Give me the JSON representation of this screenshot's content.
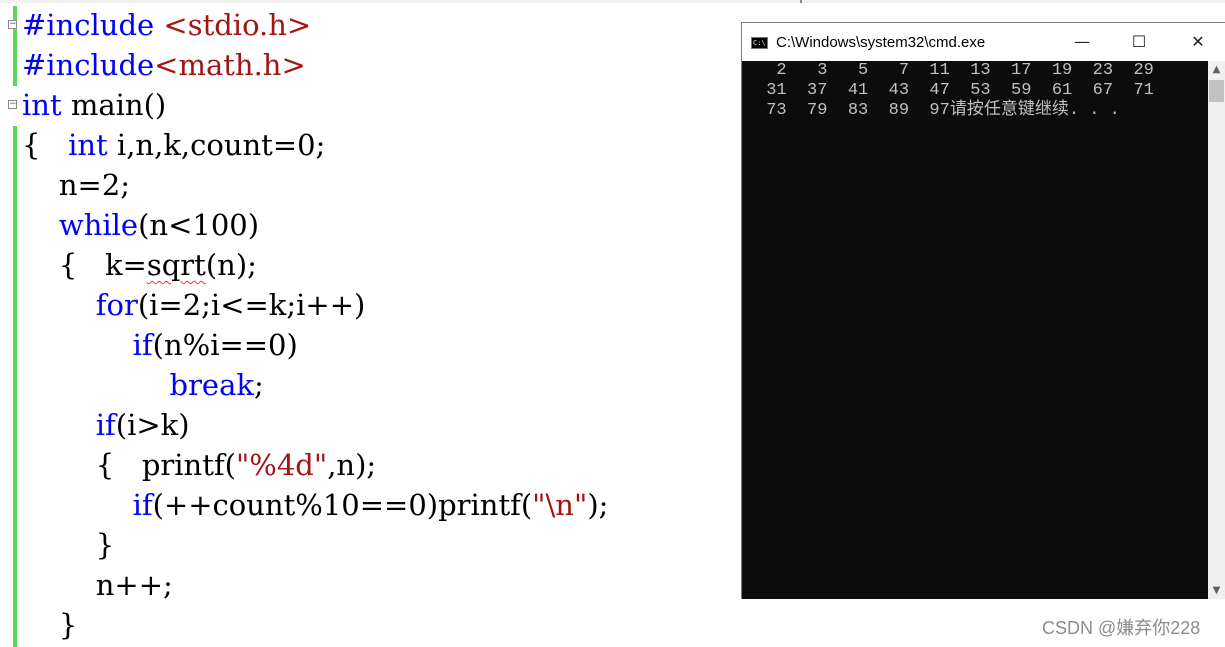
{
  "editor": {
    "lines": [
      {
        "parts": [
          {
            "t": "#include ",
            "c": "pp"
          },
          {
            "t": "<stdio.h>",
            "c": "inc"
          }
        ]
      },
      {
        "parts": [
          {
            "t": "#include",
            "c": "pp"
          },
          {
            "t": "<math.h>",
            "c": "inc"
          }
        ]
      },
      {
        "parts": [
          {
            "t": "int",
            "c": "kw"
          },
          {
            "t": " main()",
            "c": ""
          }
        ]
      },
      {
        "parts": [
          {
            "t": "{   ",
            "c": ""
          },
          {
            "t": "int",
            "c": "kw"
          },
          {
            "t": " i,n,k,count=0;",
            "c": ""
          }
        ]
      },
      {
        "parts": [
          {
            "t": "    n=2;",
            "c": ""
          }
        ]
      },
      {
        "parts": [
          {
            "t": "    ",
            "c": ""
          },
          {
            "t": "while",
            "c": "kw"
          },
          {
            "t": "(n<100)",
            "c": ""
          }
        ]
      },
      {
        "parts": [
          {
            "t": "    {   k=",
            "c": ""
          },
          {
            "t": "sqrt",
            "c": "squig"
          },
          {
            "t": "(n);",
            "c": ""
          }
        ]
      },
      {
        "parts": [
          {
            "t": "        ",
            "c": ""
          },
          {
            "t": "for",
            "c": "kw"
          },
          {
            "t": "(i=2;i<=k;i++)",
            "c": ""
          }
        ]
      },
      {
        "parts": [
          {
            "t": "            ",
            "c": ""
          },
          {
            "t": "if",
            "c": "kw"
          },
          {
            "t": "(n%i==0)",
            "c": ""
          }
        ]
      },
      {
        "parts": [
          {
            "t": "                ",
            "c": ""
          },
          {
            "t": "break",
            "c": "kw"
          },
          {
            "t": ";",
            "c": ""
          }
        ]
      },
      {
        "parts": [
          {
            "t": "        ",
            "c": ""
          },
          {
            "t": "if",
            "c": "kw"
          },
          {
            "t": "(i>k)",
            "c": ""
          }
        ]
      },
      {
        "parts": [
          {
            "t": "        {   printf(",
            "c": ""
          },
          {
            "t": "\"%4d\"",
            "c": "str"
          },
          {
            "t": ",n);",
            "c": ""
          }
        ]
      },
      {
        "parts": [
          {
            "t": "            ",
            "c": ""
          },
          {
            "t": "if",
            "c": "kw"
          },
          {
            "t": "(++count%10==0)printf(",
            "c": ""
          },
          {
            "t": "\"\\n\"",
            "c": "str"
          },
          {
            "t": ");",
            "c": ""
          }
        ]
      },
      {
        "parts": [
          {
            "t": "        }",
            "c": ""
          }
        ]
      },
      {
        "parts": [
          {
            "t": "        n++;",
            "c": ""
          }
        ]
      },
      {
        "parts": [
          {
            "t": "    }",
            "c": ""
          }
        ]
      }
    ]
  },
  "console_window": {
    "title": "C:\\Windows\\system32\\cmd.exe",
    "icon_text": "C:\\",
    "minimize_label": "—",
    "maximize_label": "☐",
    "close_label": "✕",
    "output_lines": [
      "  2   3   5   7  11  13  17  19  23  29",
      " 31  37  41  43  47  53  59  61  67  71",
      " 73  79  83  89  97请按任意键继续. . ."
    ],
    "scroll_up": "▲",
    "scroll_down": "▼"
  },
  "watermark": "CSDN @嫌弃你228"
}
